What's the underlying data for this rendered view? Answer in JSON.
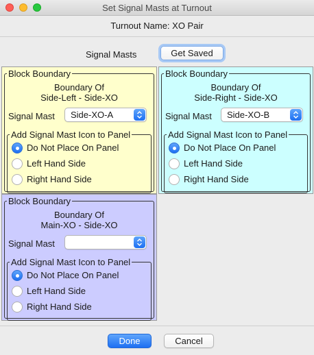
{
  "window": {
    "title": "Set Signal Masts at Turnout"
  },
  "header": {
    "turnout_name": "Turnout Name: XO Pair"
  },
  "signal_masts": {
    "label": "Signal Masts",
    "get_saved_label": "Get Saved"
  },
  "panels": [
    {
      "legend": "Block Boundary",
      "boundary_line1": "Boundary Of",
      "boundary_line2": "Side-Left - Side-XO",
      "mast_label": "Signal Mast",
      "mast_value": "Side-XO-A",
      "icon_legend": "Add Signal Mast Icon to Panel",
      "options": [
        "Do Not Place On Panel",
        "Left Hand Side",
        "Right Hand Side"
      ],
      "selected_option": "Do Not Place On Panel",
      "bg_color": "#ffffcc"
    },
    {
      "legend": "Block Boundary",
      "boundary_line1": "Boundary Of",
      "boundary_line2": "Side-Right - Side-XO",
      "mast_label": "Signal Mast",
      "mast_value": "Side-XO-B",
      "icon_legend": "Add Signal Mast Icon to Panel",
      "options": [
        "Do Not Place On Panel",
        "Left Hand Side",
        "Right Hand Side"
      ],
      "selected_option": "Do Not Place On Panel",
      "bg_color": "#ccffff"
    },
    {
      "legend": "Block Boundary",
      "boundary_line1": "Boundary Of",
      "boundary_line2": "Main-XO - Side-XO",
      "mast_label": "Signal Mast",
      "mast_value": "",
      "icon_legend": "Add Signal Mast Icon to Panel",
      "options": [
        "Do Not Place On Panel",
        "Left Hand Side",
        "Right Hand Side"
      ],
      "selected_option": "Do Not Place On Panel",
      "bg_color": "#ccccff"
    }
  ],
  "footer": {
    "done_label": "Done",
    "cancel_label": "Cancel"
  },
  "colors": {
    "accent": "#1d6ff2",
    "focus_ring": "#a8c9f5"
  },
  "icons": {
    "window_close": "close-icon",
    "window_minimize": "minimize-icon",
    "window_zoom": "zoom-icon",
    "select_arrows": "chevron-updown-icon"
  }
}
